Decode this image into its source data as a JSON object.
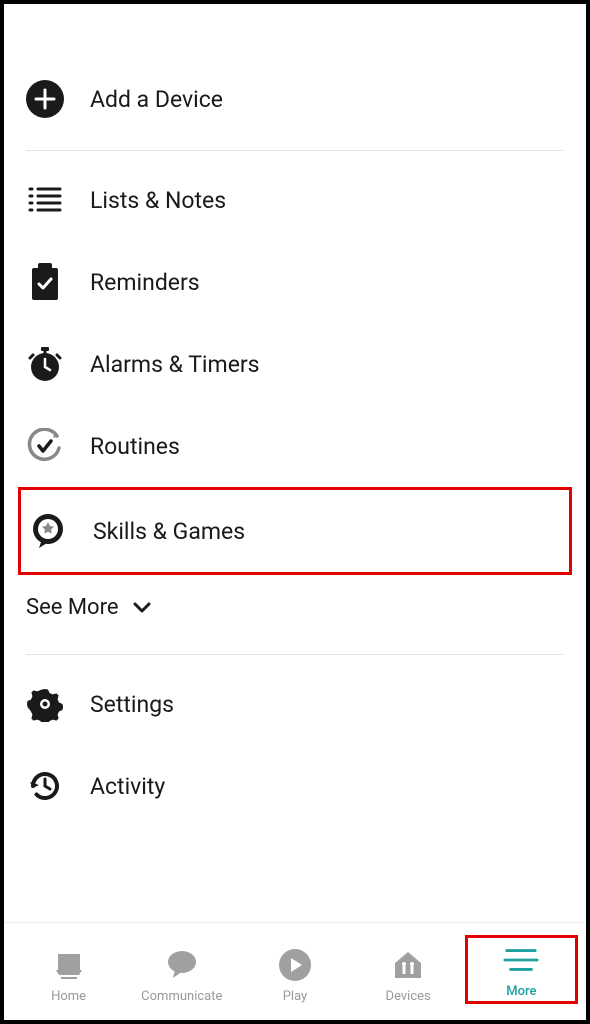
{
  "menu": {
    "add_device": "Add a Device",
    "lists_notes": "Lists & Notes",
    "reminders": "Reminders",
    "alarms_timers": "Alarms & Timers",
    "routines": "Routines",
    "skills_games": "Skills & Games",
    "see_more": "See More",
    "settings": "Settings",
    "activity": "Activity"
  },
  "nav": {
    "home": "Home",
    "communicate": "Communicate",
    "play": "Play",
    "devices": "Devices",
    "more": "More"
  }
}
